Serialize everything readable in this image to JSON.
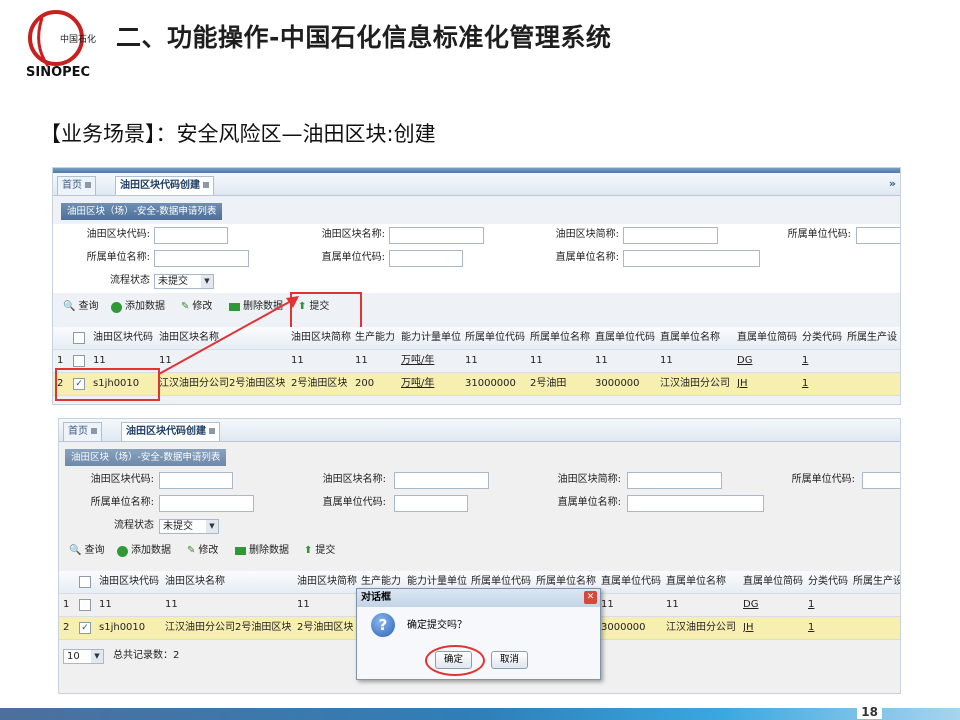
{
  "slide": {
    "logo_text": "中国石化",
    "logo_brand": "SINOPEC",
    "title": "二、功能操作-中国石化信息标准化管理系统",
    "scene": "【业务场景】：安全风险区—油田区块:创建",
    "page_number": "18"
  },
  "tabs": {
    "home": "首页",
    "active": "油田区块代码创建"
  },
  "list_title": "油田区块（场）-安全-数据申请列表",
  "form": {
    "code_label": "油田区块代码:",
    "name_label": "油田区块名称:",
    "short_label": "油田区块简称:",
    "owner_code_label": "所属单位代码:",
    "owner_name_label": "所属单位名称:",
    "direct_code_label": "直属单位代码:",
    "direct_name_label": "直属单位名称:",
    "status_label": "流程状态",
    "status_value": "未提交"
  },
  "toolbar": {
    "query": "查询",
    "add": "添加数据",
    "edit": "修改",
    "delete": "删除数据",
    "submit": "提交"
  },
  "columns": [
    "油田区块代码",
    "油田区块名称",
    "油田区块简称",
    "生产能力",
    "能力计量单位",
    "所属单位代码",
    "所属单位名称",
    "直属单位代码",
    "直属单位名称",
    "直属单位简码",
    "分类代码",
    "所属生产设"
  ],
  "rows": [
    {
      "index": "1",
      "checked": false,
      "code": "11",
      "name": "11",
      "short": "11",
      "capacity": "11",
      "unit": "万吨/年",
      "owner_code": "11",
      "owner_name": "11",
      "direct_code": "11",
      "direct_name": "11",
      "direct_short": "DG",
      "category": "1"
    },
    {
      "index": "2",
      "checked": true,
      "code": "s1jh0010",
      "name": "江汉油田分公司2号油田区块",
      "short": "2号油田区块",
      "capacity": "200",
      "unit": "万吨/年",
      "owner_code": "31000000",
      "owner_name": "2号油田",
      "direct_code": "3000000",
      "direct_name": "江汉油田分公司",
      "direct_short": "JH",
      "category": "1"
    }
  ],
  "pager": {
    "page_size": "10",
    "total": "总共记录数：2"
  },
  "dialog": {
    "title": "对话框",
    "message": "确定提交吗？",
    "ok": "确定",
    "cancel": "取消"
  },
  "colors": {
    "accent": "#4d6f98",
    "highlight": "#f7efb0",
    "callout": "#e23333"
  }
}
